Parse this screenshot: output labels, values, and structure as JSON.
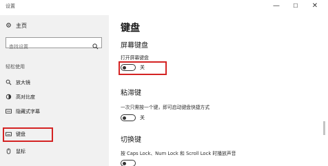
{
  "window": {
    "title": "设置",
    "minimize": "—",
    "maximize": "☐",
    "close": "✕"
  },
  "sidebar": {
    "home_label": "主页",
    "search_placeholder": "查找设置",
    "section_label": "轻松使用",
    "items": [
      {
        "label": "放大镜",
        "icon": "magnifier-icon"
      },
      {
        "label": "高对比度",
        "icon": "contrast-icon"
      },
      {
        "label": "隐藏式字幕",
        "icon": "captions-icon"
      },
      {
        "label": "键盘",
        "icon": "keyboard-icon",
        "active": true
      },
      {
        "label": "鼠标",
        "icon": "mouse-icon"
      }
    ]
  },
  "main": {
    "title": "键盘",
    "osk": {
      "heading": "屏幕键盘",
      "desc": "打开屏幕键盘",
      "state": "关",
      "on": false
    },
    "sticky": {
      "heading": "粘滞键",
      "desc": "一次只需按一个键，即可启动键盘快捷方式",
      "state": "关",
      "on": false
    },
    "toggle_keys": {
      "heading": "切换键",
      "desc": "按 Caps Lock、Num Lock 和 Scroll Lock 时播放声音",
      "on": false
    }
  },
  "colors": {
    "accent": "#0067c0",
    "highlight_border": "#d42222",
    "sidebar_bg": "#f1f1f1"
  }
}
